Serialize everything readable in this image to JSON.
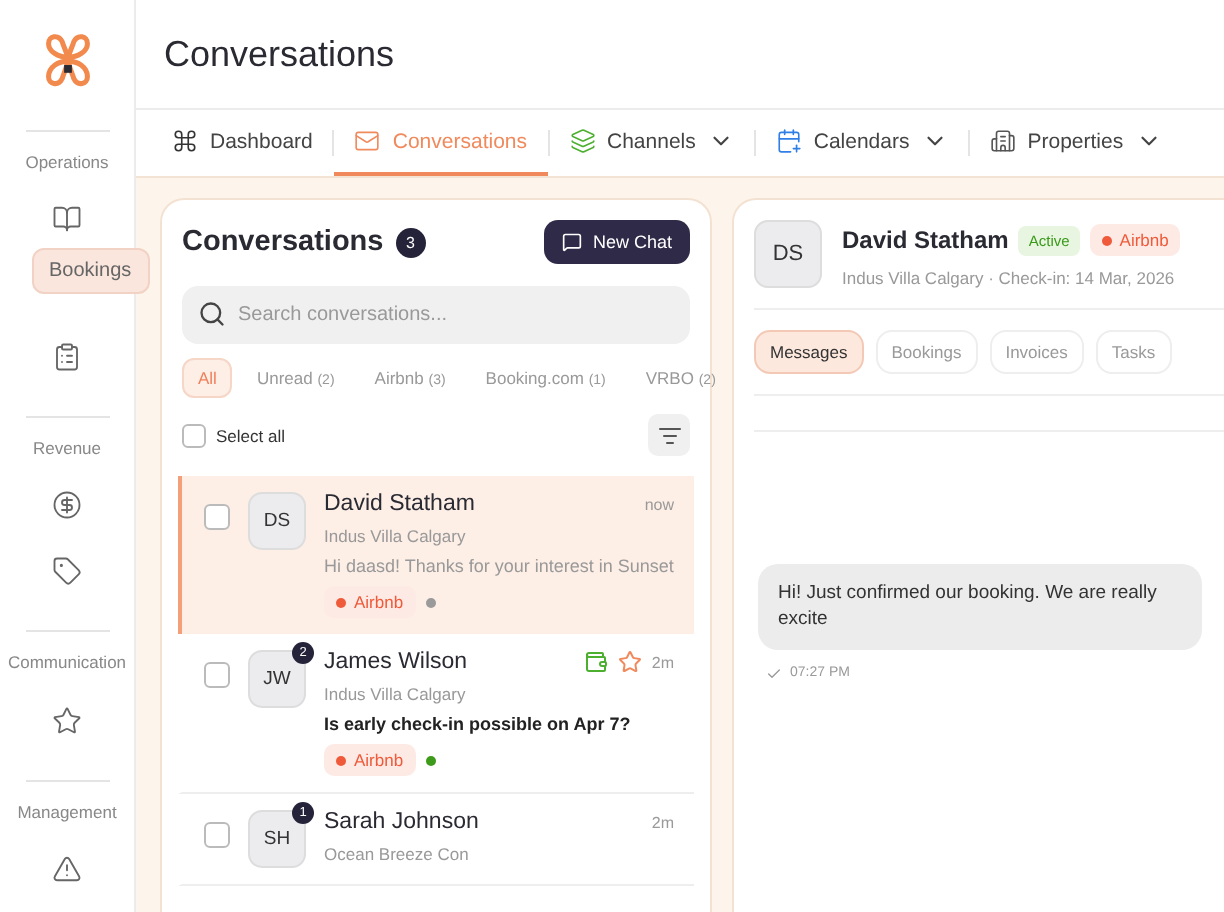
{
  "sidebar": {
    "sections": [
      {
        "title": "Operations",
        "items": [
          {
            "kind": "book",
            "tooltip": "Bookings"
          },
          {
            "kind": "checklist"
          }
        ]
      },
      {
        "title": "Revenue",
        "items": [
          {
            "kind": "dollar"
          },
          {
            "kind": "tag"
          }
        ]
      },
      {
        "title": "Communication",
        "items": [
          {
            "kind": "star"
          }
        ]
      },
      {
        "title": "Management",
        "items": [
          {
            "kind": "warning"
          }
        ]
      }
    ]
  },
  "page_title": "Conversations",
  "nav_tabs": [
    {
      "label": "Dashboard",
      "selected": false,
      "dropdown": false
    },
    {
      "label": "Conversations",
      "selected": true,
      "dropdown": false
    },
    {
      "label": "Channels",
      "selected": false,
      "dropdown": true
    },
    {
      "label": "Calendars",
      "selected": false,
      "dropdown": true
    },
    {
      "label": "Properties",
      "selected": false,
      "dropdown": true
    }
  ],
  "list_panel": {
    "title": "Conversations",
    "count": "3",
    "new_button": "New Chat",
    "search": {
      "placeholder": "Search conversations..."
    },
    "filters": [
      {
        "label": "All",
        "selected": true
      },
      {
        "label": "Unread",
        "count": "(2)",
        "selected": false
      },
      {
        "label": "Airbnb",
        "count": "(3)",
        "selected": false
      },
      {
        "label": "Booking.com",
        "count": "(1)",
        "selected": false
      },
      {
        "label": "VRBO",
        "count": "(2)",
        "selected": false
      }
    ],
    "select_all": {
      "label": "Select all",
      "checked": false
    },
    "conversations": [
      {
        "initials": "DS",
        "name": "David Statham",
        "time": "now",
        "property": "Indus Villa Calgary",
        "message": "Hi daasd! Thanks for your interest in Sunset",
        "channel": "Airbnb",
        "color": "#9a9a9a",
        "selected": true,
        "checked": false,
        "unread": false
      },
      {
        "initials": "JW",
        "unread_count": "2",
        "name": "James Wilson",
        "time": "2m",
        "property": "Indus Villa Calgary",
        "message": "Is early check-in possible on Apr 7?",
        "channel": "Airbnb",
        "color": "#3e9a1a",
        "selected": false,
        "checked": false,
        "unread": true,
        "payment": true,
        "starred": true
      },
      {
        "initials": "SH",
        "unread_count": "1",
        "name": "Sarah Johnson",
        "time": "2m",
        "property": "Ocean Breeze Con",
        "selected": false,
        "checked": false
      }
    ]
  },
  "detail_panel": {
    "initials": "DS",
    "name": "David Statham",
    "status": "Active",
    "channel": "Airbnb",
    "subtitle": "Indus Villa Calgary · Check-in: 14 Mar, 2026",
    "tabs": [
      {
        "label": "Messages",
        "selected": true
      },
      {
        "label": "Bookings",
        "selected": false
      },
      {
        "label": "Invoices",
        "selected": false
      },
      {
        "label": "Tasks",
        "selected": false
      }
    ],
    "messages": [
      {
        "text": "Hi! Just confirmed our booking. We are really excite",
        "time": "07:27 PM",
        "read": true
      }
    ]
  }
}
